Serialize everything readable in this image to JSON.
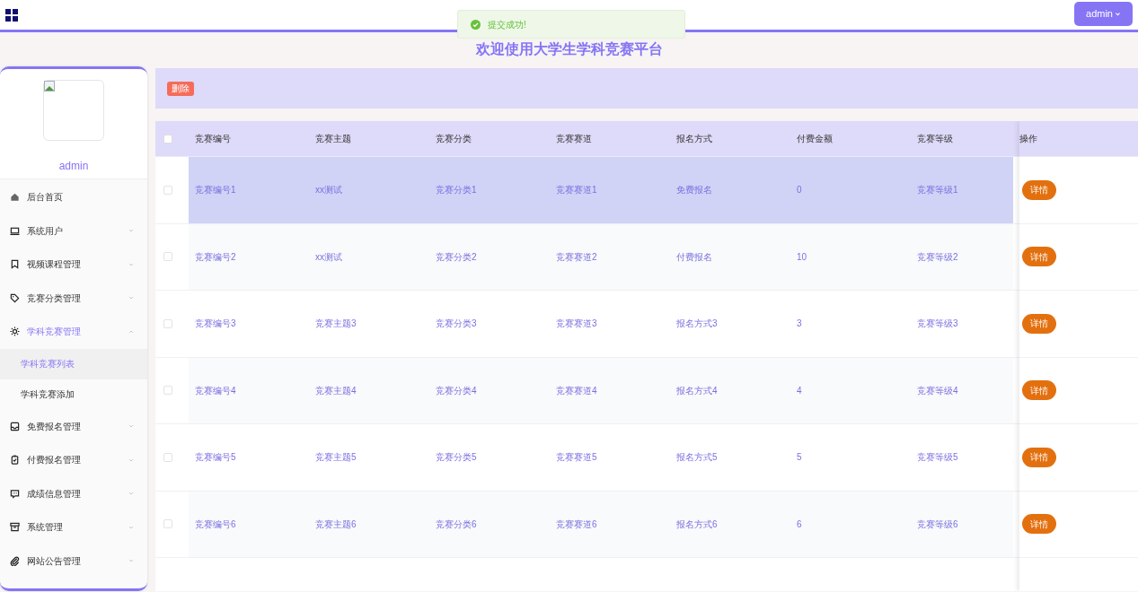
{
  "toast": {
    "message": "提交成功!"
  },
  "header": {
    "user_button": "admin",
    "title": "欢迎使用大学生学科竞赛平台"
  },
  "sidebar": {
    "username": "admin",
    "items": [
      {
        "label": "后台首页",
        "expandable": false,
        "expanded": false
      },
      {
        "label": "系统用户",
        "expandable": true,
        "expanded": false
      },
      {
        "label": "视频课程管理",
        "expandable": true,
        "expanded": false
      },
      {
        "label": "竞赛分类管理",
        "expandable": true,
        "expanded": false
      },
      {
        "label": "学科竞赛管理",
        "expandable": true,
        "expanded": true,
        "children": [
          {
            "label": "学科竞赛列表",
            "selected": true
          },
          {
            "label": "学科竞赛添加",
            "selected": false
          }
        ]
      },
      {
        "label": "免费报名管理",
        "expandable": true,
        "expanded": false
      },
      {
        "label": "付费报名管理",
        "expandable": true,
        "expanded": false
      },
      {
        "label": "成绩信息管理",
        "expandable": true,
        "expanded": false
      },
      {
        "label": "系统管理",
        "expandable": true,
        "expanded": false
      },
      {
        "label": "网站公告管理",
        "expandable": true,
        "expanded": false
      }
    ]
  },
  "toolbar": {
    "delete_button": "删除"
  },
  "table": {
    "select_all_checked": false,
    "columns": [
      "竞赛编号",
      "竞赛主题",
      "竞赛分类",
      "竞赛赛道",
      "报名方式",
      "付费金额",
      "竞赛等级",
      "操作"
    ],
    "rows": [
      {
        "cells": [
          "竞赛编号1",
          "xx测试",
          "竞赛分类1",
          "竞赛赛道1",
          "免费报名",
          "0",
          "竞赛等级1"
        ],
        "action": "详情",
        "selected": true,
        "checked": false
      },
      {
        "cells": [
          "竞赛编号2",
          "xx测试",
          "竞赛分类2",
          "竞赛赛道2",
          "付费报名",
          "10",
          "竞赛等级2"
        ],
        "action": "详情",
        "selected": false,
        "checked": false
      },
      {
        "cells": [
          "竞赛编号3",
          "竞赛主题3",
          "竞赛分类3",
          "竞赛赛道3",
          "报名方式3",
          "3",
          "竞赛等级3"
        ],
        "action": "详情",
        "selected": false,
        "checked": false
      },
      {
        "cells": [
          "竞赛编号4",
          "竞赛主题4",
          "竞赛分类4",
          "竞赛赛道4",
          "报名方式4",
          "4",
          "竞赛等级4"
        ],
        "action": "详情",
        "selected": false,
        "checked": false
      },
      {
        "cells": [
          "竞赛编号5",
          "竞赛主题5",
          "竞赛分类5",
          "竞赛赛道5",
          "报名方式5",
          "5",
          "竞赛等级5"
        ],
        "action": "详情",
        "selected": false,
        "checked": false
      },
      {
        "cells": [
          "竞赛编号6",
          "竞赛主题6",
          "竞赛分类6",
          "竞赛赛道6",
          "报名方式6",
          "6",
          "竞赛等级6"
        ],
        "action": "详情",
        "selected": false,
        "checked": false
      }
    ]
  }
}
